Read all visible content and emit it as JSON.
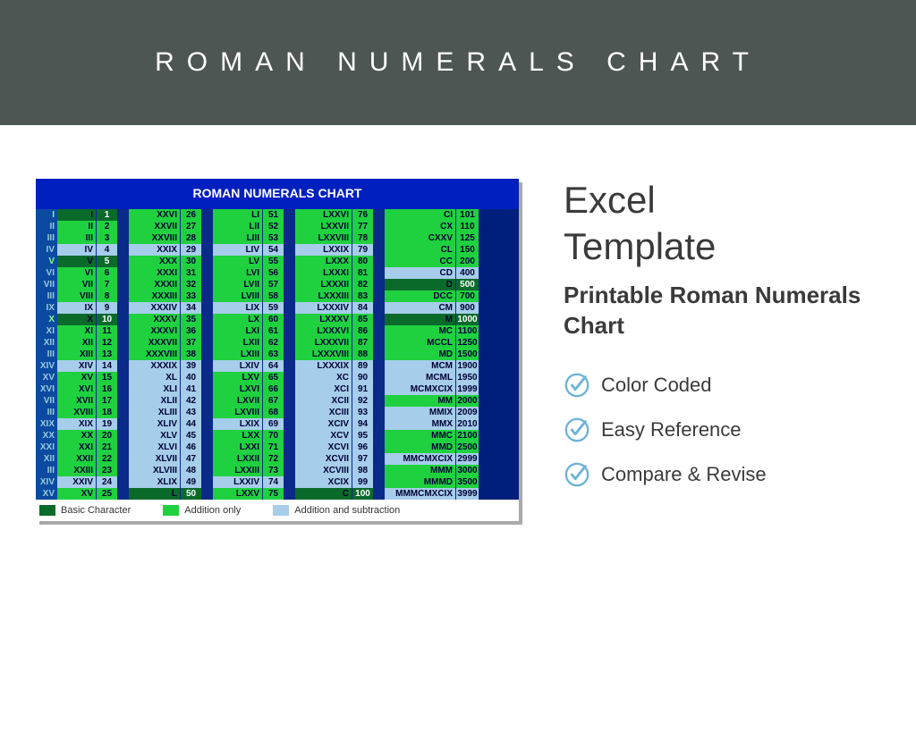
{
  "banner": "ROMAN NUMERALS CHART",
  "chart_title": "ROMAN NUMERALS CHART",
  "legend": {
    "basic": "Basic Character",
    "add": "Addition only",
    "sub": "Addition and subtraction"
  },
  "sidebar": {
    "title1": "Excel",
    "title2": "Template",
    "subtitle": "Printable Roman Numerals Chart",
    "features": [
      "Color Coded",
      "Easy Reference",
      "Compare & Revise"
    ]
  },
  "chart_data": {
    "type": "table",
    "columns": [
      {
        "rom": [
          "I",
          "II",
          "III",
          "IV",
          "V",
          "VI",
          "VII",
          "VIII",
          "IX",
          "X",
          "XI",
          "XII",
          "XIII",
          "XIV",
          "XV",
          "XVI",
          "XVII",
          "XVIII",
          "XIX",
          "XX",
          "XXI",
          "XXII",
          "XXIII",
          "XXIV",
          "XV"
        ],
        "num": [
          1,
          2,
          3,
          4,
          5,
          6,
          7,
          8,
          9,
          10,
          11,
          12,
          13,
          14,
          15,
          16,
          17,
          18,
          19,
          20,
          21,
          22,
          23,
          24,
          25
        ],
        "types": [
          "basic",
          "add",
          "add",
          "sub",
          "basic",
          "add",
          "add",
          "add",
          "sub",
          "basic",
          "add",
          "add",
          "add",
          "sub",
          "add",
          "add",
          "add",
          "add",
          "sub",
          "add",
          "add",
          "add",
          "add",
          "sub",
          "add"
        ]
      },
      {
        "rom": [
          "XXVI",
          "XXVII",
          "XXVIII",
          "XXIX",
          "XXX",
          "XXXI",
          "XXXII",
          "XXXIII",
          "XXXIV",
          "XXXV",
          "XXXVI",
          "XXXVII",
          "XXXVIII",
          "XXXIX",
          "XL",
          "XLI",
          "XLII",
          "XLIII",
          "XLIV",
          "XLV",
          "XLVI",
          "XLVII",
          "XLVIII",
          "XLIX",
          "L"
        ],
        "num": [
          26,
          27,
          28,
          29,
          30,
          31,
          32,
          33,
          34,
          35,
          36,
          37,
          38,
          39,
          40,
          41,
          42,
          43,
          44,
          45,
          46,
          47,
          48,
          49,
          50
        ],
        "types": [
          "add",
          "add",
          "add",
          "sub",
          "add",
          "add",
          "add",
          "add",
          "sub",
          "add",
          "add",
          "add",
          "add",
          "sub",
          "sub",
          "sub",
          "sub",
          "sub",
          "sub",
          "sub",
          "sub",
          "sub",
          "sub",
          "sub",
          "basic"
        ]
      },
      {
        "rom": [
          "LI",
          "LII",
          "LIII",
          "LIV",
          "LV",
          "LVI",
          "LVII",
          "LVIII",
          "LIX",
          "LX",
          "LXI",
          "LXII",
          "LXIII",
          "LXIV",
          "LXV",
          "LXVI",
          "LXVII",
          "LXVIII",
          "LXIX",
          "LXX",
          "LXXI",
          "LXXII",
          "LXXIII",
          "LXXIV",
          "LXXV"
        ],
        "num": [
          51,
          52,
          53,
          54,
          55,
          56,
          57,
          58,
          59,
          60,
          61,
          62,
          63,
          64,
          65,
          66,
          67,
          68,
          69,
          70,
          71,
          72,
          73,
          74,
          75
        ],
        "types": [
          "add",
          "add",
          "add",
          "sub",
          "add",
          "add",
          "add",
          "add",
          "sub",
          "add",
          "add",
          "add",
          "add",
          "sub",
          "add",
          "add",
          "add",
          "add",
          "sub",
          "add",
          "add",
          "add",
          "add",
          "sub",
          "add"
        ]
      },
      {
        "rom": [
          "LXXVI",
          "LXXVII",
          "LXXVIII",
          "LXXIX",
          "LXXX",
          "LXXXI",
          "LXXXII",
          "LXXXIII",
          "LXXXIV",
          "LXXXV",
          "LXXXVI",
          "LXXXVII",
          "LXXXVIII",
          "LXXXIX",
          "XC",
          "XCI",
          "XCII",
          "XCIII",
          "XCIV",
          "XCV",
          "XCVI",
          "XCVII",
          "XCVIII",
          "XCIX",
          "C"
        ],
        "num": [
          76,
          77,
          78,
          79,
          80,
          81,
          82,
          83,
          84,
          85,
          86,
          87,
          88,
          89,
          90,
          91,
          92,
          93,
          94,
          95,
          96,
          97,
          98,
          99,
          100
        ],
        "types": [
          "add",
          "add",
          "add",
          "sub",
          "add",
          "add",
          "add",
          "add",
          "sub",
          "add",
          "add",
          "add",
          "add",
          "sub",
          "sub",
          "sub",
          "sub",
          "sub",
          "sub",
          "sub",
          "sub",
          "sub",
          "sub",
          "sub",
          "basic"
        ]
      },
      {
        "rom": [
          "CI",
          "CX",
          "CXXV",
          "CL",
          "CC",
          "CD",
          "D",
          "DCC",
          "CM",
          "M",
          "MC",
          "MCCL",
          "MD",
          "MCM",
          "MCML",
          "MCMXCIX",
          "MM",
          "MMIX",
          "MMX",
          "MMC",
          "MMD",
          "MMCMXCIX",
          "MMM",
          "MMMD",
          "MMMCMXCIX"
        ],
        "num": [
          101,
          110,
          125,
          150,
          200,
          400,
          500,
          700,
          900,
          1000,
          1100,
          1250,
          1500,
          1900,
          1950,
          1999,
          2000,
          2009,
          2010,
          2100,
          2500,
          2999,
          3000,
          3500,
          3999
        ],
        "types": [
          "add",
          "add",
          "add",
          "add",
          "add",
          "sub",
          "basic",
          "add",
          "sub",
          "basic",
          "add",
          "add",
          "add",
          "sub",
          "sub",
          "sub",
          "add",
          "sub",
          "sub",
          "add",
          "add",
          "sub",
          "add",
          "add",
          "sub"
        ]
      }
    ]
  }
}
